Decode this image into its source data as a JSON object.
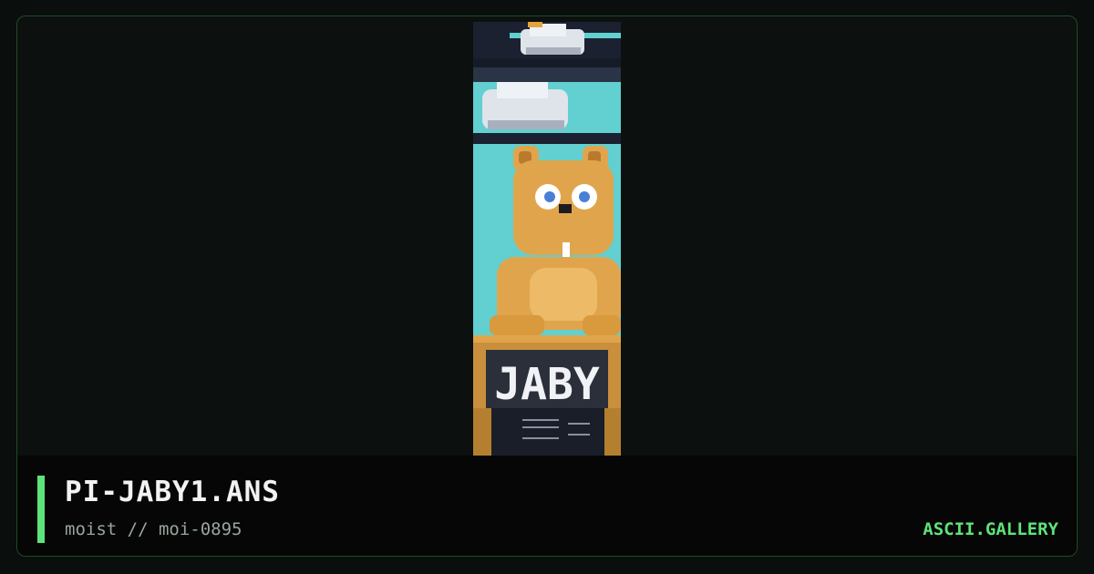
{
  "artwork": {
    "file_name": "PI-JABY1.ANS",
    "credit": "moist // moi-0895",
    "art_logo_text": "JABY",
    "icon": "ansi-art-preview"
  },
  "site": {
    "brand": "ASCII.GALLERY"
  },
  "colors": {
    "accent": "#5ee27a",
    "background": "#0a0f0d",
    "footer": "#050605",
    "sky": "#62cfd0",
    "bear": "#e0a54c"
  }
}
